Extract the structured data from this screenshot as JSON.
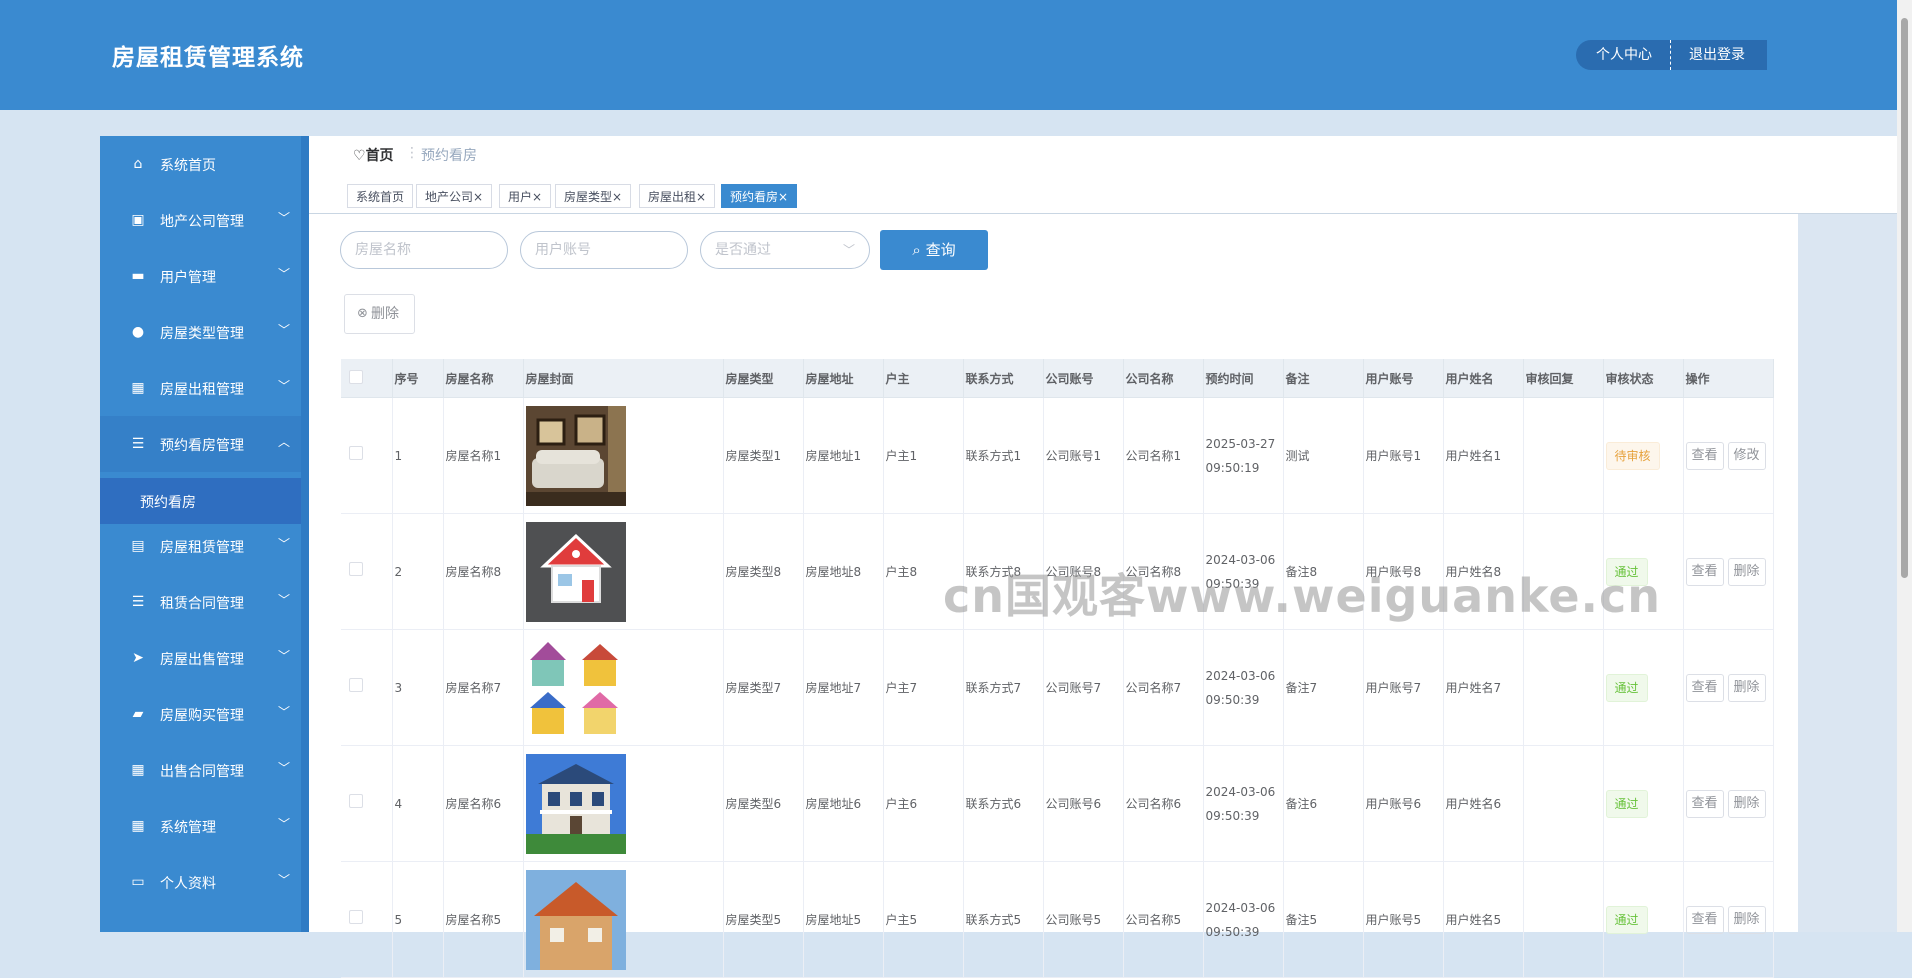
{
  "app": {
    "title": "房屋租赁管理系统"
  },
  "header": {
    "profile_label": "个人中心",
    "logout_label": "退出登录"
  },
  "sidebar": {
    "items": [
      {
        "label": "系统首页",
        "icon": "house-icon",
        "glyph": "⌂",
        "expandable": false
      },
      {
        "label": "地产公司管理",
        "icon": "chart-icon",
        "glyph": "▣",
        "expandable": true
      },
      {
        "label": "用户管理",
        "icon": "briefcase-icon",
        "glyph": "▬",
        "expandable": true
      },
      {
        "label": "房屋类型管理",
        "icon": "person-icon",
        "glyph": "●",
        "expandable": true
      },
      {
        "label": "房屋出租管理",
        "icon": "grid-icon",
        "glyph": "▦",
        "expandable": true
      },
      {
        "label": "预约看房管理",
        "icon": "sliders-icon",
        "glyph": "☰",
        "expandable": true,
        "open": true
      },
      {
        "label": "房屋租赁管理",
        "icon": "chat-icon",
        "glyph": "▤",
        "expandable": true
      },
      {
        "label": "租赁合同管理",
        "icon": "list-icon",
        "glyph": "☰",
        "expandable": true
      },
      {
        "label": "房屋出售管理",
        "icon": "send-icon",
        "glyph": "➤",
        "expandable": true
      },
      {
        "label": "房屋购买管理",
        "icon": "wallet-icon",
        "glyph": "▰",
        "expandable": true
      },
      {
        "label": "出售合同管理",
        "icon": "grid-icon",
        "glyph": "▦",
        "expandable": true
      },
      {
        "label": "系统管理",
        "icon": "grid-icon",
        "glyph": "▦",
        "expandable": true
      },
      {
        "label": "个人资料",
        "icon": "card-icon",
        "glyph": "▭",
        "expandable": true
      }
    ],
    "submenu_label": "预约看房"
  },
  "breadcrumb": {
    "home": "首页",
    "separator": "⋮",
    "current": "预约看房"
  },
  "tags": [
    {
      "label": "系统首页",
      "closable": false
    },
    {
      "label": "地产公司",
      "closable": true
    },
    {
      "label": "用户",
      "closable": true
    },
    {
      "label": "房屋类型",
      "closable": true
    },
    {
      "label": "房屋出租",
      "closable": true
    },
    {
      "label": "预约看房",
      "closable": true,
      "active": true
    }
  ],
  "search": {
    "house_name_placeholder": "房屋名称",
    "user_account_placeholder": "用户账号",
    "approved_placeholder": "是否通过",
    "query_label": "查询"
  },
  "toolbar": {
    "delete_label": "删除"
  },
  "table": {
    "headers": [
      "",
      "序号",
      "房屋名称",
      "房屋封面",
      "房屋类型",
      "房屋地址",
      "户主",
      "联系方式",
      "公司账号",
      "公司名称",
      "预约时间",
      "备注",
      "用户账号",
      "用户姓名",
      "审核回复",
      "审核状态",
      "操作"
    ],
    "rows": [
      {
        "no": "1",
        "name": "房屋名称1",
        "cover": "living-room",
        "type": "房屋类型1",
        "address": "房屋地址1",
        "owner": "户主1",
        "contact": "联系方式1",
        "company_account": "公司账号1",
        "company_name": "公司名称1",
        "time": "2025-03-27 09:50:19",
        "remark": "测试",
        "user_account": "用户账号1",
        "user_name": "用户姓名1",
        "reply": "",
        "status": "待审核",
        "status_kind": "pending",
        "op1": "查看",
        "op2": "修改"
      },
      {
        "no": "2",
        "name": "房屋名称8",
        "cover": "house-icon",
        "type": "房屋类型8",
        "address": "房屋地址8",
        "owner": "户主8",
        "contact": "联系方式8",
        "company_account": "公司账号8",
        "company_name": "公司名称8",
        "time": "2024-03-06 09:50:39",
        "remark": "备注8",
        "user_account": "用户账号8",
        "user_name": "用户姓名8",
        "reply": "",
        "status": "通过",
        "status_kind": "pass",
        "op1": "查看",
        "op2": "删除"
      },
      {
        "no": "3",
        "name": "房屋名称7",
        "cover": "cartoon-houses",
        "type": "房屋类型7",
        "address": "房屋地址7",
        "owner": "户主7",
        "contact": "联系方式7",
        "company_account": "公司账号7",
        "company_name": "公司名称7",
        "time": "2024-03-06 09:50:39",
        "remark": "备注7",
        "user_account": "用户账号7",
        "user_name": "用户姓名7",
        "reply": "",
        "status": "通过",
        "status_kind": "pass",
        "op1": "查看",
        "op2": "删除"
      },
      {
        "no": "4",
        "name": "房屋名称6",
        "cover": "villa",
        "type": "房屋类型6",
        "address": "房屋地址6",
        "owner": "户主6",
        "contact": "联系方式6",
        "company_account": "公司账号6",
        "company_name": "公司名称6",
        "time": "2024-03-06 09:50:39",
        "remark": "备注6",
        "user_account": "用户账号6",
        "user_name": "用户姓名6",
        "reply": "",
        "status": "通过",
        "status_kind": "pass",
        "op1": "查看",
        "op2": "删除"
      },
      {
        "no": "5",
        "name": "房屋名称5",
        "cover": "cabin",
        "type": "房屋类型5",
        "address": "房屋地址5",
        "owner": "户主5",
        "contact": "联系方式5",
        "company_account": "公司账号5",
        "company_name": "公司名称5",
        "time": "2024-03-06 09:50:39",
        "remark": "备注5",
        "user_account": "用户账号5",
        "user_name": "用户姓名5",
        "reply": "",
        "status": "通过",
        "status_kind": "pass",
        "op1": "查看",
        "op2": "删除"
      }
    ]
  },
  "watermark": "cn国观客www.weiguanke.cn",
  "colors": {
    "primary": "#3a8ad0",
    "header_btn": "#2a6cb0",
    "pending": "#e6a23c",
    "pass": "#67c23a"
  }
}
